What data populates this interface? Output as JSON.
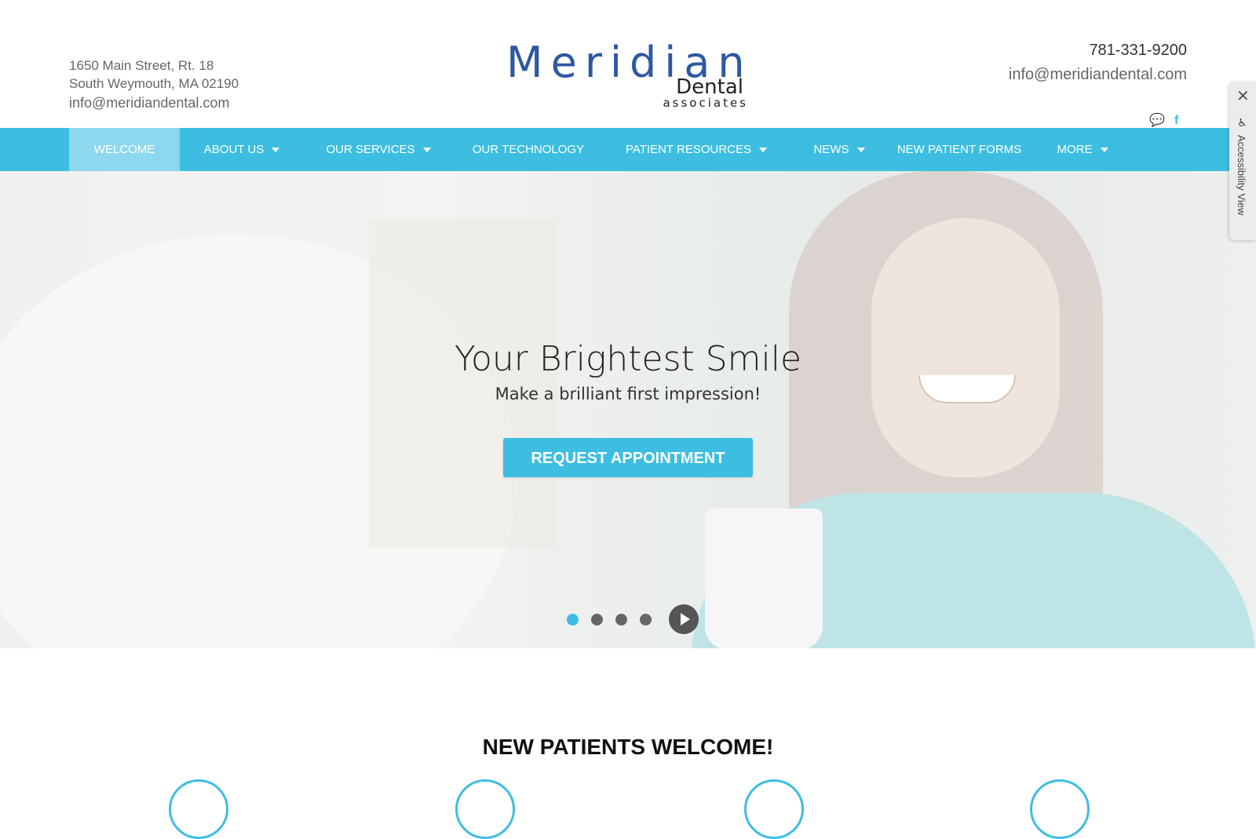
{
  "header": {
    "address_line1": "1650 Main Street, Rt. 18",
    "address_line2": "South Weymouth, MA 02190",
    "email_left": "info@meridiandental.com",
    "phone": "781-331-9200",
    "email_right": "info@meridiandental.com",
    "logo": {
      "name": "Meridian",
      "line2": "Dental",
      "line3": "associates"
    },
    "social_icons": [
      "chat-icon",
      "facebook-icon"
    ]
  },
  "nav": {
    "items": [
      {
        "label": "WELCOME",
        "active": true,
        "dropdown": false
      },
      {
        "label": "ABOUT US",
        "active": false,
        "dropdown": true
      },
      {
        "label": "OUR SERVICES",
        "active": false,
        "dropdown": true
      },
      {
        "label": "OUR TECHNOLOGY",
        "active": false,
        "dropdown": false
      },
      {
        "label": "PATIENT RESOURCES",
        "active": false,
        "dropdown": true
      },
      {
        "label": "NEWS",
        "active": false,
        "dropdown": true
      },
      {
        "label": "NEW PATIENT FORMS",
        "active": false,
        "dropdown": false
      },
      {
        "label": "MORE",
        "active": false,
        "dropdown": true
      }
    ]
  },
  "hero": {
    "title": "Your Brightest Smile",
    "subtitle": "Make a brilliant first impression!",
    "button_label": "REQUEST APPOINTMENT",
    "slides": 4,
    "active_slide": 1
  },
  "accessibility": {
    "label": "Accessibility View",
    "close_glyph": "✕"
  },
  "section": {
    "heading": "NEW PATIENTS WELCOME!"
  },
  "colors": {
    "accent": "#3dbee1",
    "logo_blue": "#2f58a3"
  }
}
